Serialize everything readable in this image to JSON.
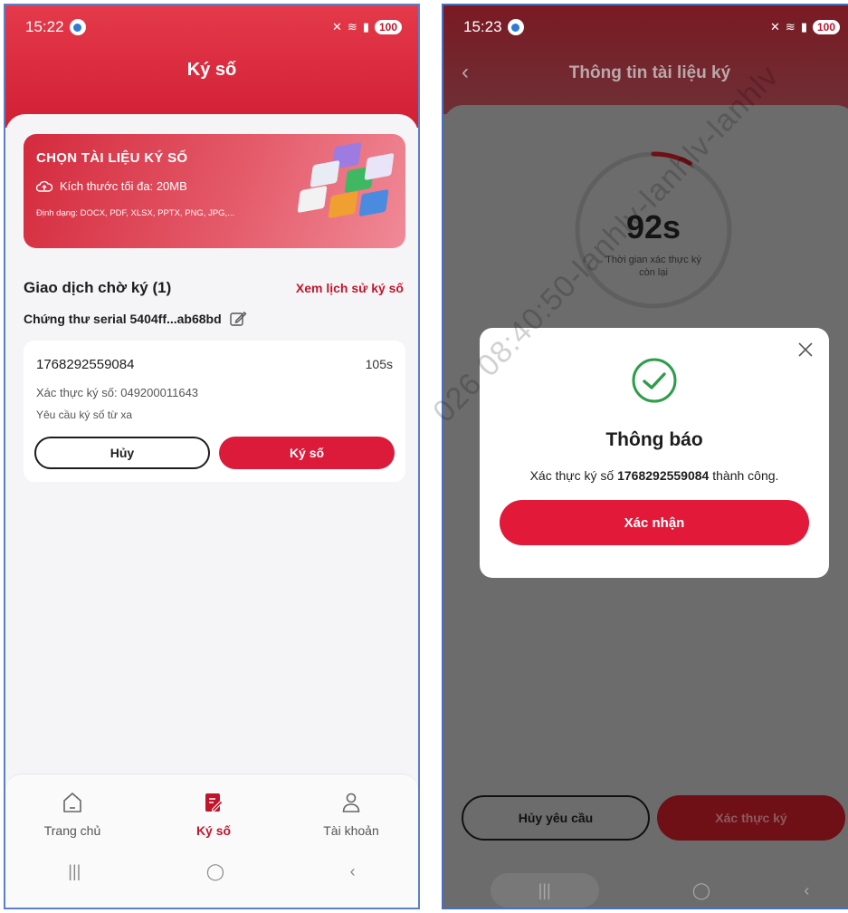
{
  "left": {
    "status": {
      "time": "15:22",
      "battery": "100"
    },
    "title": "Ký số",
    "banner": {
      "title": "CHỌN TÀI LIỆU KÝ SỐ",
      "size": "Kích thước tối đa: 20MB",
      "formats": "Định dạng: DOCX, PDF, XLSX, PPTX, PNG, JPG,..."
    },
    "section_title": "Giao dịch chờ ký (1)",
    "history_link": "Xem lịch sử ký số",
    "serial": "Chứng thư serial 5404ff...ab68bd",
    "transaction": {
      "id": "1768292559084",
      "timer": "105s",
      "auth": "Xác thực ký số: 049200011643",
      "request": "Yêu cầu ký số từ xa",
      "cancel_label": "Hủy",
      "sign_label": "Ký số"
    },
    "nav": [
      {
        "label": "Trang chủ",
        "icon": "home-icon"
      },
      {
        "label": "Ký số",
        "icon": "sign-document-icon"
      },
      {
        "label": "Tài khoản",
        "icon": "account-icon"
      }
    ]
  },
  "right": {
    "status": {
      "time": "15:23",
      "battery": "100"
    },
    "title": "Thông tin tài liệu ký",
    "timer": {
      "value": "92s",
      "label": "Thời gian xác thực ký còn lại",
      "progress": 0.08
    },
    "dialog": {
      "title": "Thông báo",
      "msg_prefix": "Xác thực ký số ",
      "msg_id": "1768292559084",
      "msg_suffix": " thành công.",
      "confirm_label": "Xác nhận"
    },
    "cancel_request_label": "Hủy yêu cầu",
    "verify_label": "Xác thực ký"
  },
  "watermark": "026 08:40:50-lanhlv-lanhlv-lanhlv",
  "colors": {
    "brand_red": "#dc1a3a",
    "success_green": "#2e9e4a"
  }
}
